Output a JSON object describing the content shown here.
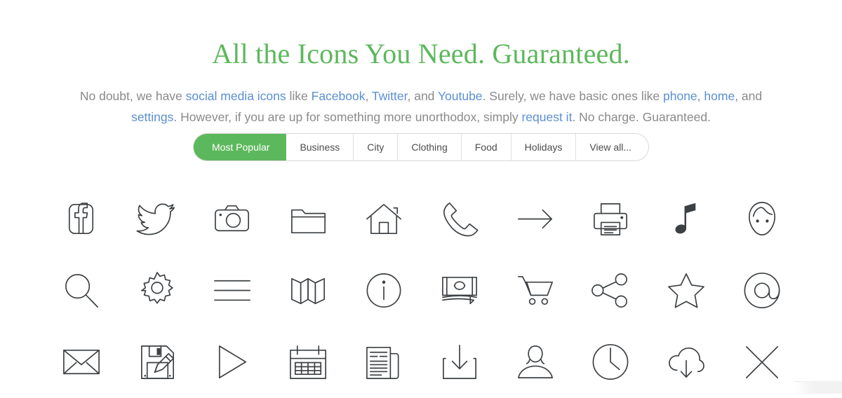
{
  "headline": "All the Icons You Need. Guaranteed.",
  "colors": {
    "accent_green": "#5cb85c",
    "link_blue": "#5b8fd4",
    "body_gray": "#8a8a8a",
    "icon_stroke": "#3c4043"
  },
  "subtitle": {
    "s1": "No doubt, we have ",
    "l1": "social media icons",
    "s2": " like ",
    "l2": "Facebook",
    "s3": ", ",
    "l3": "Twitter",
    "s4": ", and ",
    "l4": "Youtube",
    "s5": ". Surely, we have basic ones like ",
    "l5": "phone",
    "s6": ", ",
    "l6": "home",
    "s7": ", and ",
    "l7": "settings",
    "s8": ". However, if you are up for something more unorthodox, simply ",
    "l8": "request it",
    "s9": ". No charge. Guaranteed."
  },
  "tabs": [
    {
      "label": "Most Popular",
      "active": true
    },
    {
      "label": "Business",
      "active": false
    },
    {
      "label": "City",
      "active": false
    },
    {
      "label": "Clothing",
      "active": false
    },
    {
      "label": "Food",
      "active": false
    },
    {
      "label": "Holidays",
      "active": false
    },
    {
      "label": "View all...",
      "active": false
    }
  ],
  "icons": [
    {
      "name": "facebook-icon",
      "label": "Facebook"
    },
    {
      "name": "twitter-icon",
      "label": "Twitter"
    },
    {
      "name": "camera-icon",
      "label": "Camera"
    },
    {
      "name": "folder-icon",
      "label": "Folder"
    },
    {
      "name": "home-icon",
      "label": "Home"
    },
    {
      "name": "phone-icon",
      "label": "Phone"
    },
    {
      "name": "arrow-right-icon",
      "label": "Arrow right"
    },
    {
      "name": "printer-icon",
      "label": "Printer"
    },
    {
      "name": "music-note-icon",
      "label": "Music note"
    },
    {
      "name": "face-avatar-icon",
      "label": "Face"
    },
    {
      "name": "search-icon",
      "label": "Search"
    },
    {
      "name": "gear-icon",
      "label": "Settings"
    },
    {
      "name": "hamburger-menu-icon",
      "label": "Menu"
    },
    {
      "name": "map-icon",
      "label": "Map"
    },
    {
      "name": "info-icon",
      "label": "Info"
    },
    {
      "name": "money-cash-icon",
      "label": "Money"
    },
    {
      "name": "shopping-cart-icon",
      "label": "Shopping cart"
    },
    {
      "name": "share-icon",
      "label": "Share"
    },
    {
      "name": "star-icon",
      "label": "Star"
    },
    {
      "name": "at-sign-icon",
      "label": "At sign"
    },
    {
      "name": "envelope-icon",
      "label": "Mail"
    },
    {
      "name": "floppy-disk-edit-icon",
      "label": "Save and edit"
    },
    {
      "name": "play-icon",
      "label": "Play"
    },
    {
      "name": "calendar-icon",
      "label": "Calendar"
    },
    {
      "name": "newspaper-icon",
      "label": "Newspaper"
    },
    {
      "name": "download-icon",
      "label": "Download"
    },
    {
      "name": "user-icon",
      "label": "User"
    },
    {
      "name": "clock-icon",
      "label": "Clock"
    },
    {
      "name": "cloud-download-icon",
      "label": "Cloud download"
    },
    {
      "name": "close-x-icon",
      "label": "Close"
    }
  ]
}
